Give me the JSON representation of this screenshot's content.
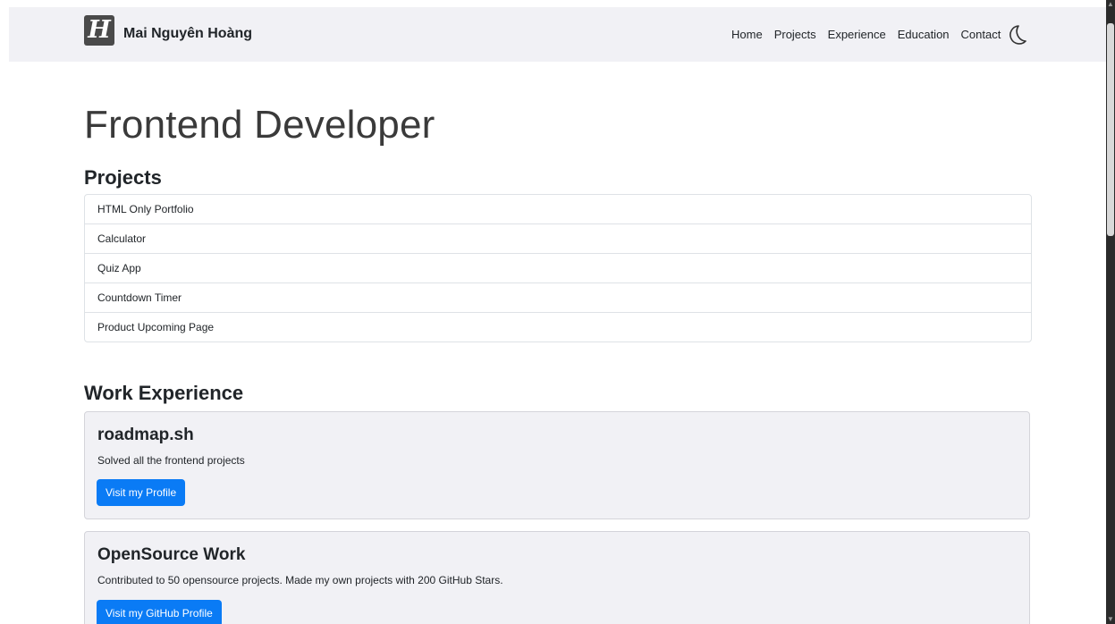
{
  "brand": {
    "logo_letter": "H",
    "name": "Mai Nguyên Hoàng"
  },
  "nav": {
    "links": [
      "Home",
      "Projects",
      "Experience",
      "Education",
      "Contact"
    ],
    "theme_toggle_icon": "moon-icon"
  },
  "hero": {
    "title": "Frontend Developer"
  },
  "projects": {
    "heading": "Projects",
    "items": [
      "HTML Only Portfolio",
      "Calculator",
      "Quiz App",
      "Countdown Timer",
      "Product Upcoming Page"
    ]
  },
  "experience": {
    "heading": "Work Experience",
    "cards": [
      {
        "title": "roadmap.sh",
        "text": "Solved all the frontend projects",
        "button": "Visit my Profile"
      },
      {
        "title": "OpenSource Work",
        "text": "Contributed to 50 opensource projects. Made my own projects with 200 GitHub Stars.",
        "button": "Visit my GitHub Profile"
      }
    ]
  },
  "colors": {
    "navbar_bg": "#f1f1f5",
    "card_bg": "#f1f1f5",
    "button_bg": "#0a7bf5",
    "logo_bg": "#4a4a4a"
  }
}
